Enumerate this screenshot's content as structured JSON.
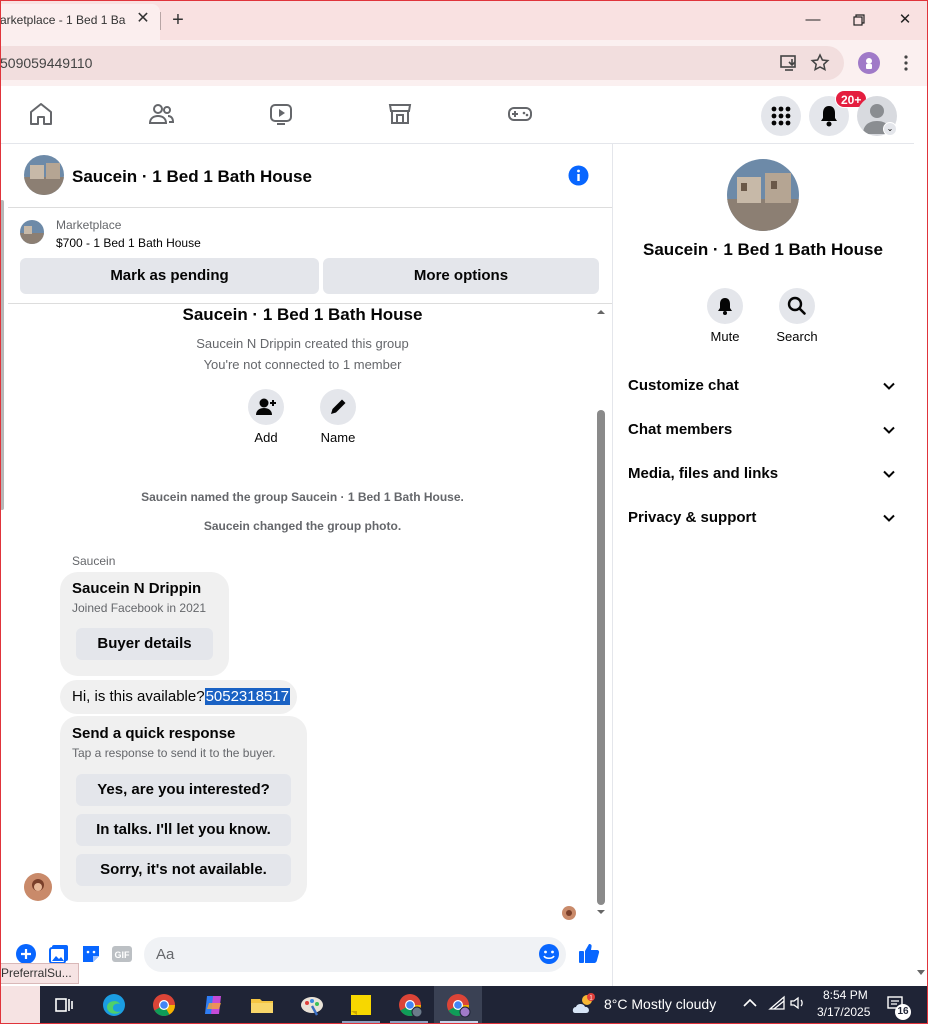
{
  "browser": {
    "tab_title": "arketplace - 1 Bed 1 Ba",
    "url": "509059449110"
  },
  "facebook": {
    "notification_badge": "20+"
  },
  "chat": {
    "title": "Saucein · 1 Bed 1 Bath House",
    "listing_label": "Marketplace",
    "listing_price": "$700 - 1 Bed 1 Bath House",
    "btn_pending": "Mark as pending",
    "btn_more": "More options",
    "group_title": "Saucein · 1 Bed 1 Bath House",
    "group_created": "Saucein N Drippin created this group",
    "group_not_connected": "You're not connected to 1 member",
    "action_add": "Add",
    "action_name": "Name",
    "sys_named": "Saucein named the group Saucein · 1 Bed 1 Bath House.",
    "sys_photo": "Saucein changed the group photo.",
    "sender": "Saucein",
    "card_name": "Saucein N Drippin",
    "card_joined": "Joined Facebook in 2021",
    "card_button": "Buyer details",
    "message_text": "Hi, is this available?",
    "message_phone": "5052318517",
    "quick_title": "Send a quick response",
    "quick_sub": "Tap a response to send it to the buyer.",
    "quick_responses": [
      "Yes, are you interested?",
      "In talks. I'll let you know.",
      "Sorry, it's not available."
    ],
    "input_placeholder": "Aa"
  },
  "right_panel": {
    "title": "Saucein · 1 Bed 1 Bath House",
    "mute_label": "Mute",
    "search_label": "Search",
    "sections": [
      "Customize chat",
      "Chat members",
      "Media, files and links",
      "Privacy & support"
    ]
  },
  "status_tip": "PreferralSu...",
  "taskbar": {
    "weather": "8°C  Mostly cloudy",
    "time": "8:54 PM",
    "date": "3/17/2025",
    "notifications": "16"
  },
  "icons": [
    "home-icon",
    "friends-icon",
    "video-icon",
    "marketplace-icon",
    "gaming-icon",
    "menu-grid-icon",
    "bell-icon",
    "info-icon",
    "add-person-icon",
    "pencil-icon",
    "plus-icon",
    "image-icon",
    "sticker-icon",
    "gif-icon",
    "emoji-icon",
    "like-icon",
    "search-icon",
    "chevron-down-icon"
  ],
  "colors": {
    "accent": "#0866ff",
    "badge": "#e41e3f",
    "selection": "#1a62c4"
  }
}
